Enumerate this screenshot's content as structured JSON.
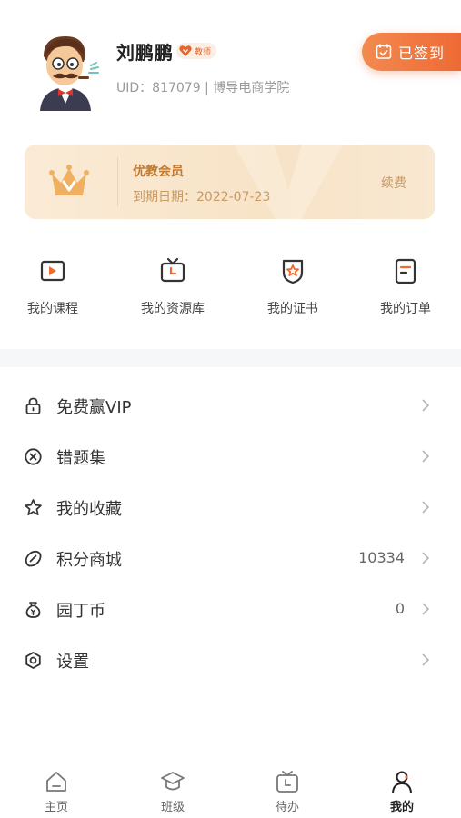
{
  "profile": {
    "name": "刘鹏鹏",
    "role_badge": "教师",
    "uid_line": "UID：817079 | 博导电商学院",
    "checkin_label": "已签到"
  },
  "membership": {
    "title": "优教会员",
    "expiry": "到期日期：2022-07-23",
    "renew_label": "续费"
  },
  "shortcuts": [
    {
      "label": "我的课程",
      "icon": "course-video-icon"
    },
    {
      "label": "我的资源库",
      "icon": "resource-tv-icon"
    },
    {
      "label": "我的证书",
      "icon": "certificate-badge-icon"
    },
    {
      "label": "我的订单",
      "icon": "order-document-icon"
    }
  ],
  "menu": [
    {
      "label": "免费赢VIP",
      "value": "",
      "icon": "lock-icon"
    },
    {
      "label": "错题集",
      "value": "",
      "icon": "error-circle-x-icon"
    },
    {
      "label": "我的收藏",
      "value": "",
      "icon": "star-icon"
    },
    {
      "label": "积分商城",
      "value": "10334",
      "icon": "points-icon"
    },
    {
      "label": "园丁币",
      "value": "0",
      "icon": "coin-bag-icon"
    },
    {
      "label": "设置",
      "value": "",
      "icon": "settings-icon"
    }
  ],
  "tabs": [
    {
      "label": "主页",
      "icon": "home-icon",
      "active": false
    },
    {
      "label": "班级",
      "icon": "graduation-cap-icon",
      "active": false
    },
    {
      "label": "待办",
      "icon": "todo-tv-icon",
      "active": false
    },
    {
      "label": "我的",
      "icon": "user-icon",
      "active": true
    }
  ],
  "colors": {
    "accent": "#ee6a35",
    "gold_text": "#c27a2f",
    "card_bg": "#f8e6cd"
  }
}
